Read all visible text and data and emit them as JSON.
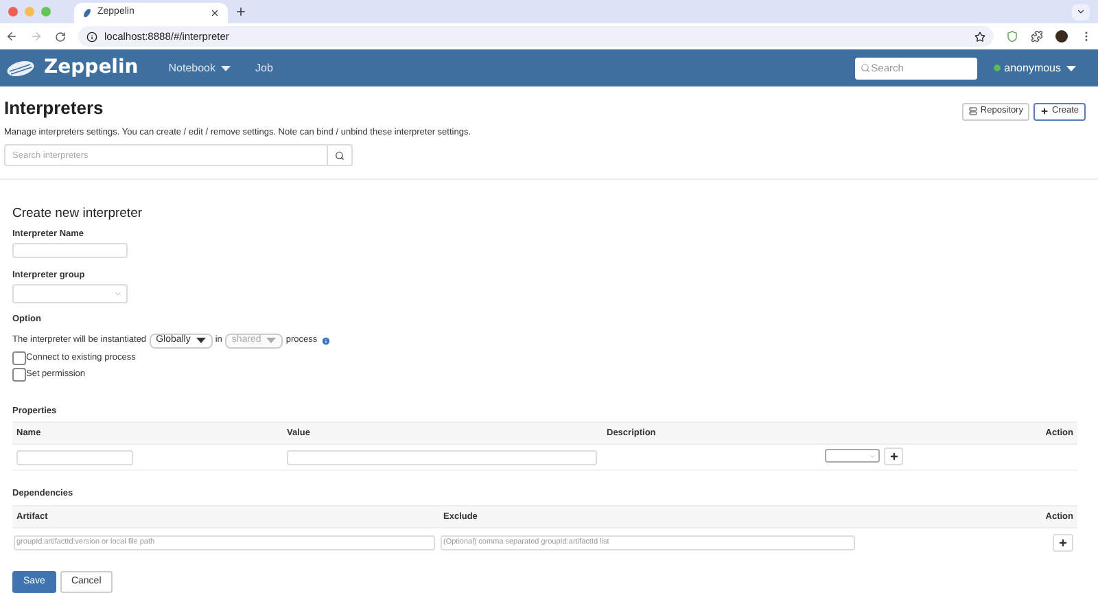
{
  "browser": {
    "tab_title": "Zeppelin",
    "url": "localhost:8888/#/interpreter"
  },
  "navbar": {
    "brand": "Zeppelin",
    "menu": [
      {
        "label": "Notebook",
        "dropdown": true
      },
      {
        "label": "Job",
        "dropdown": false
      }
    ],
    "search": {
      "placeholder": "Search"
    },
    "user": {
      "name": "anonymous",
      "online": true
    }
  },
  "page": {
    "title": "Interpreters",
    "description": "Manage interpreters settings. You can create / edit / remove settings. Note can bind / unbind these interpreter settings.",
    "buttons": [
      {
        "label": "Repository",
        "kind": "repository",
        "selected": false
      },
      {
        "label": "Create",
        "kind": "create",
        "selected": true
      }
    ],
    "search": {
      "placeholder": "Search interpreters"
    }
  },
  "form": {
    "title": "Create new interpreter",
    "name_label": "Interpreter Name",
    "group_label": "Interpreter group",
    "option_label": "Option",
    "option_sentence": {
      "before": "The interpreter will be instantiated",
      "scope": {
        "value": "Globally",
        "disabled": false
      },
      "middle": "in",
      "mode": {
        "value": "shared",
        "disabled": true
      },
      "after": "process"
    },
    "checkboxes": [
      {
        "label": "Connect to existing process",
        "checked": false
      },
      {
        "label": "Set permission",
        "checked": false
      }
    ],
    "properties": {
      "title": "Properties",
      "columns": [
        "Name",
        "Value",
        "Description",
        "Action"
      ]
    },
    "dependencies": {
      "title": "Dependencies",
      "columns": [
        "Artifact",
        "Exclude",
        "Action"
      ],
      "artifact_placeholder": "groupId:artifactId:version or local file path",
      "exclude_placeholder": "(Optional) comma separated groupId:artifactId list"
    },
    "buttons": [
      {
        "label": "Save",
        "kind": "primary"
      },
      {
        "label": "Cancel",
        "kind": "default"
      }
    ]
  }
}
